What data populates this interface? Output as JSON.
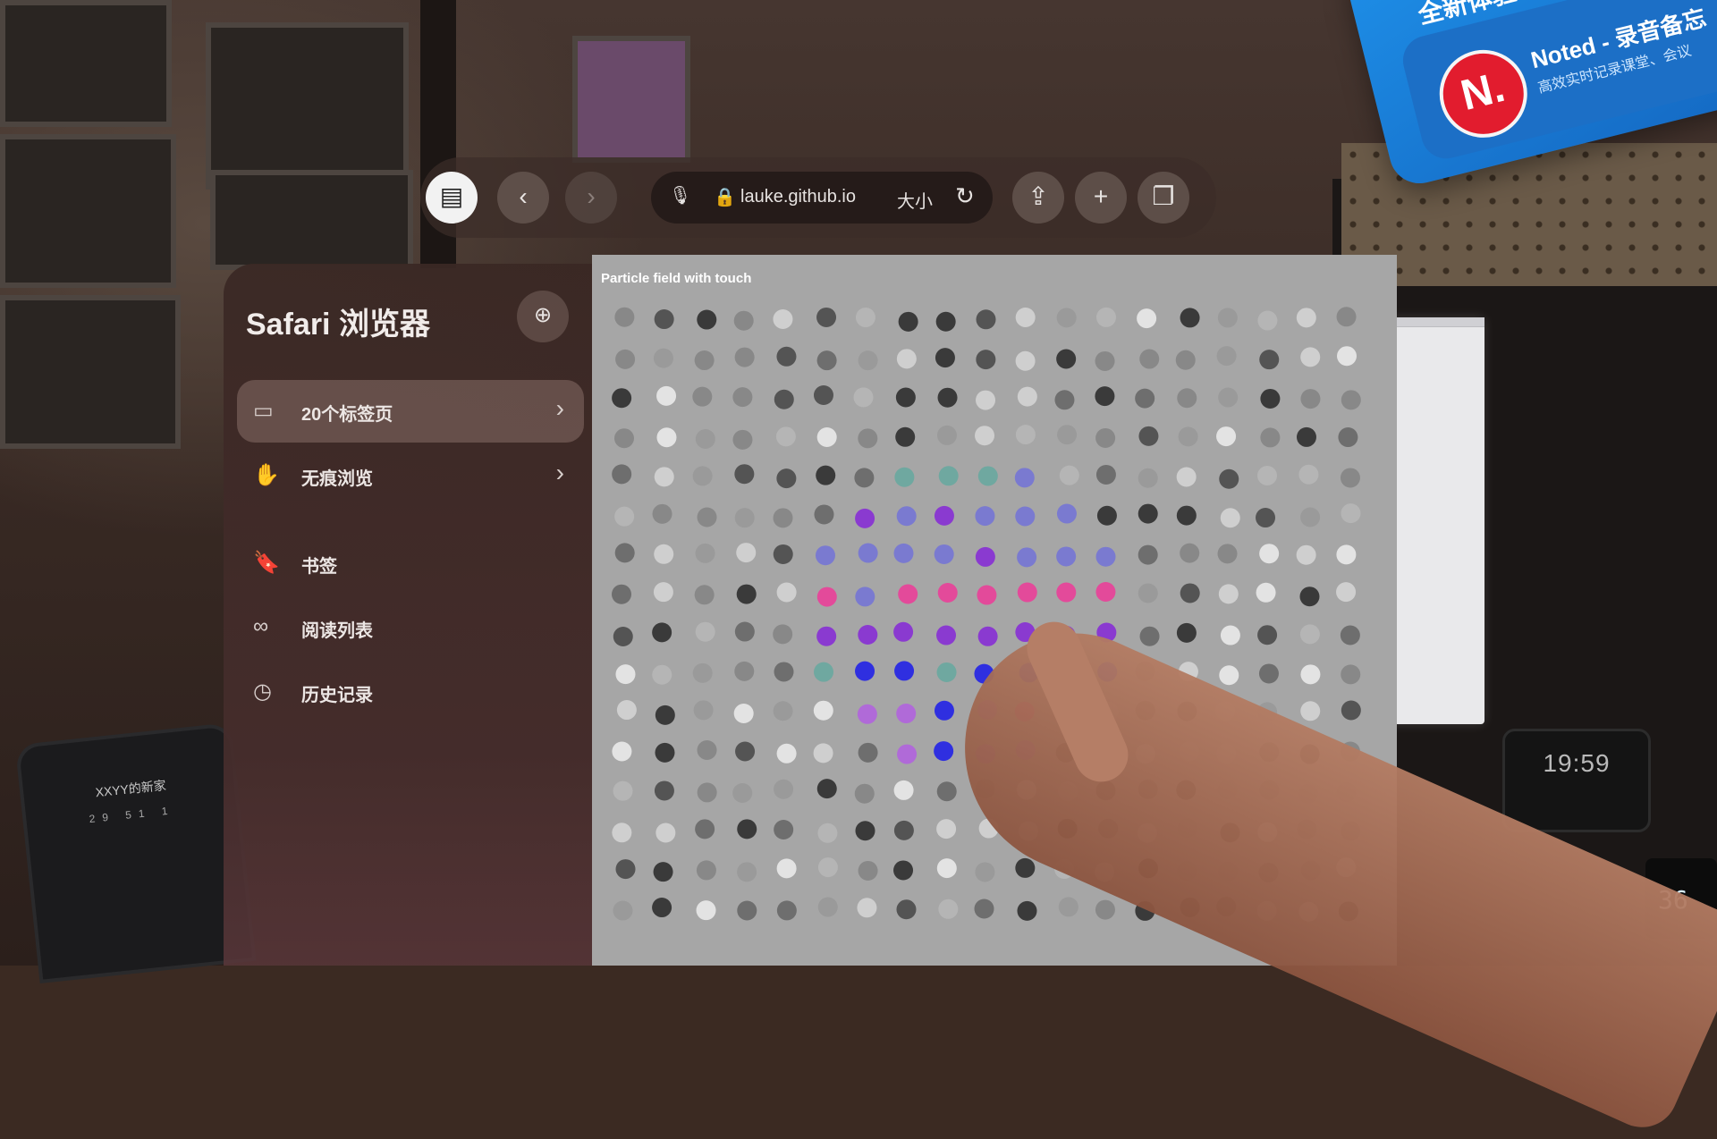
{
  "window": {
    "notification": {
      "header": "全新体验",
      "header_chevron": "›",
      "app_logo": "N.",
      "title": "Noted - 录音备忘",
      "subtitle": "高效实时记录课堂、会议"
    }
  },
  "toolbar": {
    "sidebar_icon": "▤",
    "back_icon": "‹",
    "forward_icon": "›",
    "mic_icon": "🎙",
    "lock_icon": "🔒",
    "url": "lauke.github.io",
    "text_size_label": "大小",
    "reload_icon": "↻",
    "share_icon": "⇪",
    "new_tab_icon": "+",
    "tabs_icon": "❐"
  },
  "sidebar": {
    "title": "Safari 浏览器",
    "new_tab_group_icon": "⊕",
    "items": [
      {
        "label": "20个标签页",
        "icon": "▭",
        "chevron": "›"
      },
      {
        "label": "无痕浏览",
        "icon": "✋",
        "chevron": "›"
      },
      {
        "label": "书签",
        "icon": "🔖"
      },
      {
        "label": "阅读列表",
        "icon": "∞"
      },
      {
        "label": "历史记录",
        "icon": "◷"
      }
    ]
  },
  "content": {
    "caption": "Particle field with touch",
    "grid": {
      "cols": 19,
      "rows": 16
    },
    "accent_colors": [
      "#6fa8a0",
      "#7a7ad0",
      "#8a3ad0",
      "#e34a9a",
      "#2f2fe0",
      "#b06ad8"
    ]
  },
  "environment": {
    "clock": "19:59",
    "badge": "36",
    "phone_title": "XXYY的新家",
    "phone_stats": "29 51 1"
  }
}
